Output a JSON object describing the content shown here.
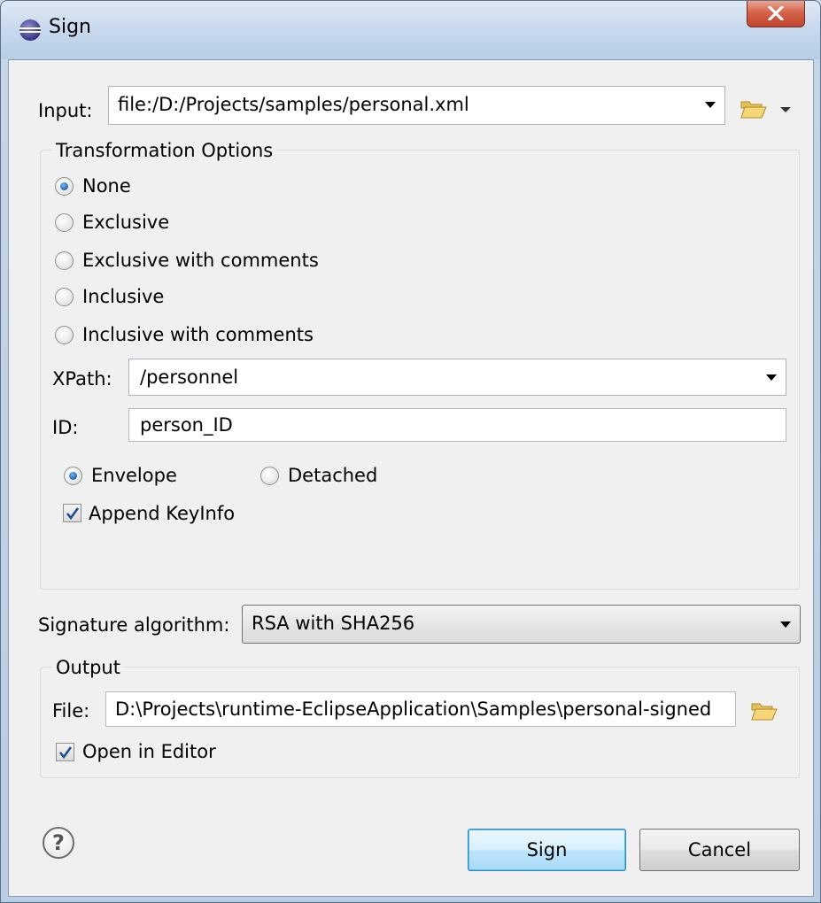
{
  "window": {
    "title": "Sign"
  },
  "input": {
    "label": "Input:",
    "value": "file:/D:/Projects/samples/personal.xml"
  },
  "transformation": {
    "group_title": "Transformation Options",
    "options": [
      "None",
      "Exclusive",
      "Exclusive with comments",
      "Inclusive",
      "Inclusive with comments"
    ],
    "selected": "None",
    "xpath_label": "XPath:",
    "xpath_value": "/personnel",
    "id_label": "ID:",
    "id_value": "person_ID",
    "envelope_label": "Envelope",
    "detached_label": "Detached",
    "append_keyinfo_label": "Append KeyInfo",
    "append_keyinfo_checked": true
  },
  "signature": {
    "label": "Signature algorithm:",
    "value": "RSA with SHA256"
  },
  "output": {
    "group_title": "Output",
    "file_label": "File:",
    "file_value": "D:\\Projects\\runtime-EclipseApplication\\Samples\\personal-signed",
    "open_in_editor_label": "Open in Editor",
    "open_in_editor_checked": true
  },
  "buttons": {
    "sign": "Sign",
    "cancel": "Cancel",
    "help": "?"
  },
  "colors": {
    "accent": "#2a6fc0",
    "default_button_border": "#3c7fb1",
    "close_button": "#c2442d"
  },
  "icons": [
    "eclipse-icon",
    "close-icon",
    "folder-open-icon",
    "dropdown-arrow-icon",
    "help-icon"
  ]
}
